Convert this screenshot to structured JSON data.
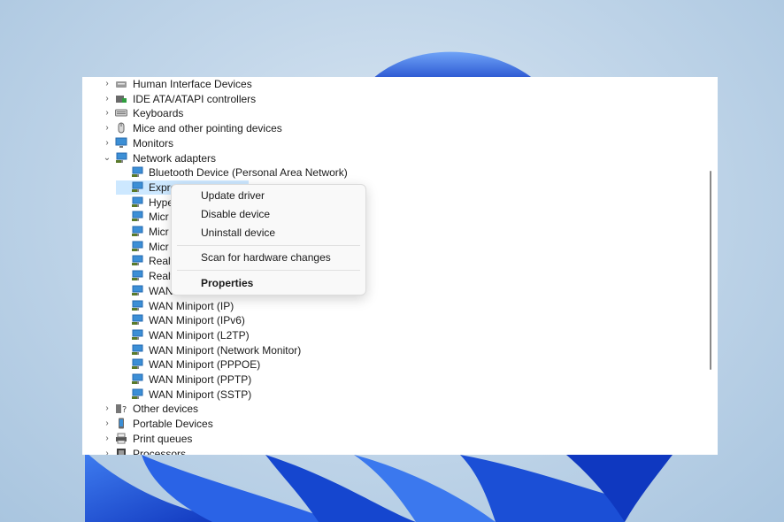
{
  "tree": {
    "top_categories": [
      {
        "label": "Human Interface Devices",
        "icon": "hid-icon"
      },
      {
        "label": "IDE ATA/ATAPI controllers",
        "icon": "ide-controller-icon"
      },
      {
        "label": "Keyboards",
        "icon": "keyboard-icon"
      },
      {
        "label": "Mice and other pointing devices",
        "icon": "mouse-icon"
      },
      {
        "label": "Monitors",
        "icon": "monitor-icon"
      }
    ],
    "expanded_category": {
      "label": "Network adapters",
      "icon": "network-adapter-icon",
      "expanded": true
    },
    "children": [
      {
        "label": "Bluetooth Device (Personal Area Network)"
      },
      {
        "label": "Expre",
        "selected": true
      },
      {
        "label": "Hype"
      },
      {
        "label": "Micr"
      },
      {
        "label": "Micr"
      },
      {
        "label": "Micr"
      },
      {
        "label": "Realt"
      },
      {
        "label": "Realt"
      },
      {
        "label": "WAN"
      },
      {
        "label": "WAN Miniport (IP)"
      },
      {
        "label": "WAN Miniport (IPv6)"
      },
      {
        "label": "WAN Miniport (L2TP)"
      },
      {
        "label": "WAN Miniport (Network Monitor)"
      },
      {
        "label": "WAN Miniport (PPPOE)"
      },
      {
        "label": "WAN Miniport (PPTP)"
      },
      {
        "label": "WAN Miniport (SSTP)"
      }
    ],
    "bottom_categories": [
      {
        "label": "Other devices",
        "icon": "unknown-device-icon"
      },
      {
        "label": "Portable Devices",
        "icon": "portable-device-icon"
      },
      {
        "label": "Print queues",
        "icon": "printer-icon"
      },
      {
        "label": "Processors",
        "icon": "processor-icon"
      }
    ]
  },
  "context_menu": {
    "update_driver": "Update driver",
    "disable_device": "Disable device",
    "uninstall_device": "Uninstall device",
    "scan_hardware": "Scan for hardware changes",
    "properties": "Properties"
  },
  "colors": {
    "selection": "#cde8ff",
    "bloom_blue": "#1f5be0",
    "adapter_icon": "#3c8fd6"
  }
}
